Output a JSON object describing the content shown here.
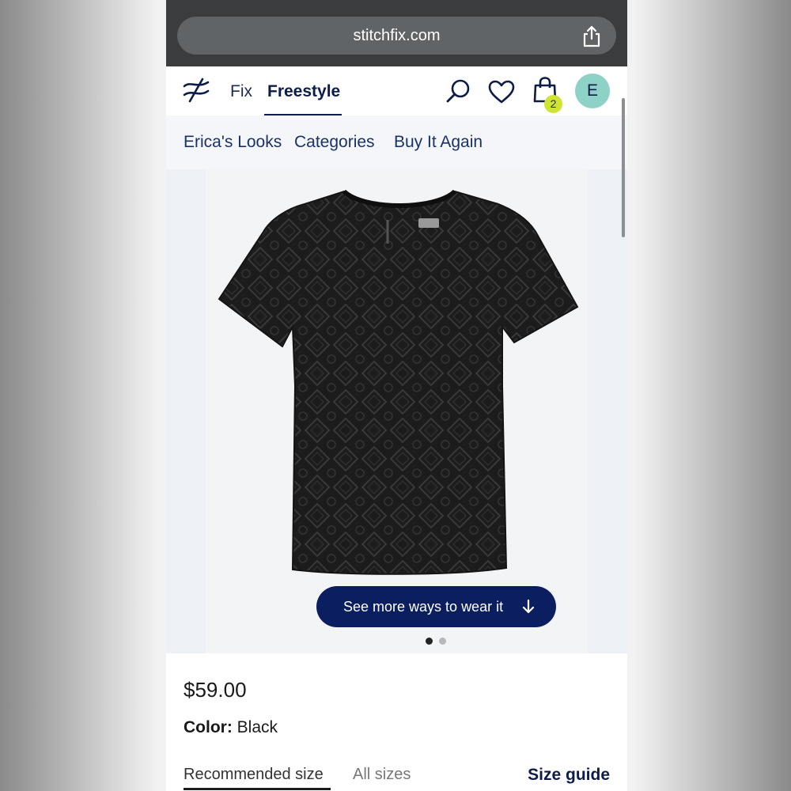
{
  "browser": {
    "url": "stitchfix.com",
    "share_icon": "share-icon"
  },
  "header": {
    "logo_icon": "stitch-fix-logo-icon",
    "nav": {
      "fix": "Fix",
      "freestyle": "Freestyle"
    },
    "icons": [
      "search-icon",
      "heart-icon",
      "shopping-bag-icon"
    ],
    "bag_count": "2",
    "avatar_initial": "E",
    "colors": {
      "navy": "#0d1c48",
      "badge": "#cfe335",
      "avatar": "#8ed1c6"
    }
  },
  "subnav": {
    "items": [
      "Erica's Looks",
      "Categories",
      "Buy It Again"
    ]
  },
  "product": {
    "image_icon": "black-lace-tshirt-image",
    "ways_button": "See more ways to wear it",
    "carousel": {
      "current": 1,
      "total": 2
    },
    "price": "$59.00",
    "color_label": "Color:",
    "color_value": "Black",
    "size_tabs": {
      "recommended": "Recommended size",
      "all": "All sizes"
    },
    "size_guide": "Size guide"
  }
}
